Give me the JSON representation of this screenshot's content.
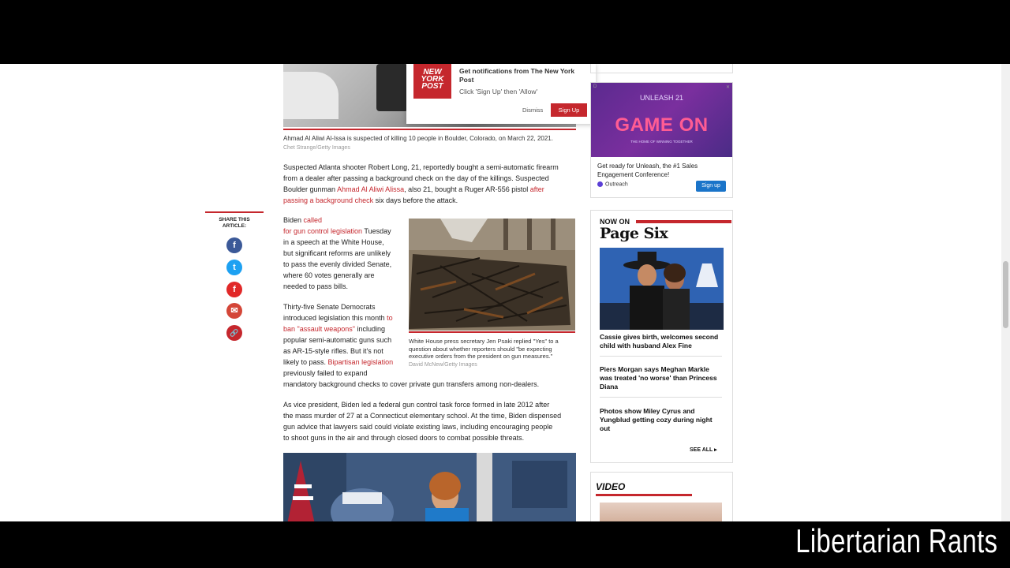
{
  "notification": {
    "logo_text": "NEW YORK POST",
    "title": "Get notifications from The New York Post",
    "subtitle": "Click 'Sign Up' then 'Allow'",
    "dismiss_label": "Dismiss",
    "signup_label": "Sign Up"
  },
  "article": {
    "top_caption": "Ahmad Al Aliwi Al-Issa is suspected of killing 10 people in Boulder, Colorado, on March 22, 2021.",
    "top_credit": "Chet Strange/Getty Images",
    "p1_text_a": "Suspected Atlanta shooter Robert Long, 21, reportedly bought a semi-automatic firearm",
    "p1_text_b": "from a dealer after passing a background check on the day of the killings. Suspected",
    "p1_text_c": "Boulder gunman",
    "p1_link_a": "Ahmad Al Aliwi Alissa",
    "p1_text_d": ", also 21, bought a Ruger AR-556 pistol",
    "p1_link_b1": "after",
    "p1_link_b2": "passing a background check",
    "p1_text_e": "six days before the attack.",
    "p2_text_a": "Biden",
    "p2_link_a1": "called",
    "p2_link_a2": "for gun control legislation",
    "p2_text_b": "Tuesday",
    "p2_line3": "in a speech at the White House,",
    "p2_line4": "but significant reforms are unlikely",
    "p2_line5": "to pass the evenly divided Senate,",
    "p2_line6": "where 60 votes generally are",
    "p2_line7": "needed to pass bills.",
    "p3_line1a": "Thirty-five Senate Democrats",
    "p3_line2a": "introduced legislation this month",
    "p3_link_a1": "to",
    "p3_link_a2": "ban \"assault weapons\"",
    "p3_text_b": "including",
    "p3_line4": "popular semi-automatic guns such",
    "p3_line5": "as AR-15-style rifles. But it's not",
    "p3_line6a": "likely to pass.",
    "p3_link_b": "Bipartisan legislation",
    "p3_line7": "previously failed to expand",
    "p3_line8": "mandatory background checks to cover private gun transfers among non-dealers.",
    "inline_caption": "White House press secretary Jen Psaki replied \"Yes\" to a question about whether reporters should \"be expecting executive orders from the president on gun measures.\"",
    "inline_credit": "David McNew/Getty Images",
    "p4_line1": "As vice president, Biden led a federal gun control task force formed in late 2012 after",
    "p4_line2": "the mass murder of 27 at a Connecticut elementary school. At the time, Biden dispensed",
    "p4_line3": "gun advice that lawyers said could violate existing laws, including encouraging people",
    "p4_line4": "to shoot guns in the air and through closed doors to combat possible threats."
  },
  "share": {
    "label": "SHARE THIS ARTICLE:",
    "icons": [
      "f",
      "t",
      "f",
      "✉",
      "🔗"
    ]
  },
  "ad": {
    "badge": "D",
    "close": "✕",
    "brand": "UNLEASH 21",
    "headline": "GAME ON",
    "tagline": "THE HOME OF WINNING TOGETHER",
    "text": "Get ready for Unleash, the #1 Sales Engagement Conference!",
    "advertiser": "Outreach",
    "cta": "Sign up"
  },
  "page_six": {
    "now_on": "NOW ON",
    "title": "Page Six",
    "stories": [
      "Cassie gives birth, welcomes second child with husband Alex Fine",
      "Piers Morgan says Meghan Markle was treated 'no worse' than Princess Diana",
      "Photos show Miley Cyrus and Yungblud getting cozy during night out"
    ],
    "see_all": "SEE ALL"
  },
  "video": {
    "title": "VIDEO"
  },
  "watermark": "Libertarian Rants",
  "colors": {
    "accent": "#c5272d",
    "link": "#c5272d",
    "facebook": "#3b5998",
    "twitter": "#1da1f2",
    "flipboard": "#e12828",
    "email": "#d44638",
    "copylink": "#c5272d"
  }
}
